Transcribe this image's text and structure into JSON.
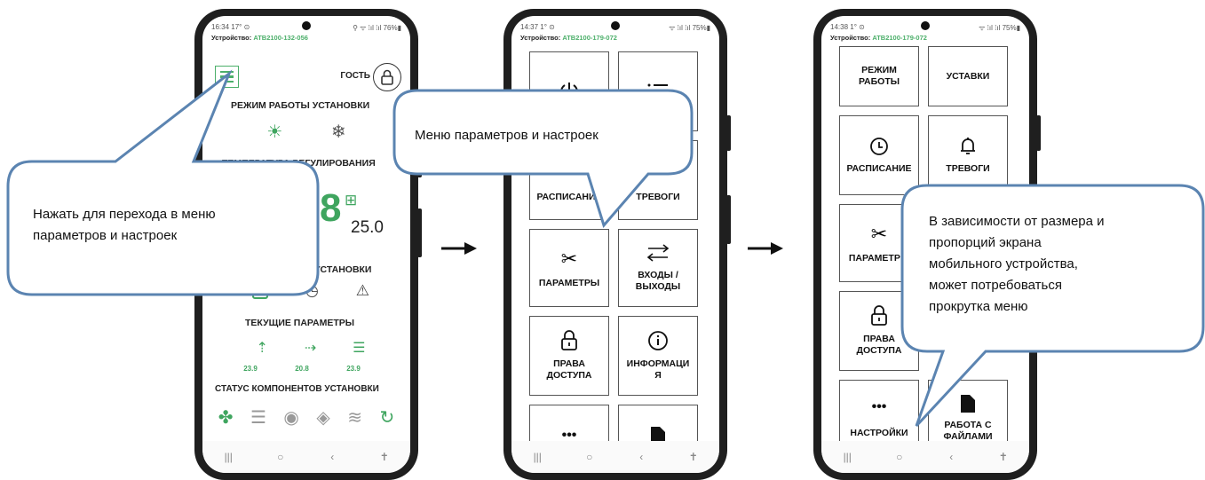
{
  "phones": [
    {
      "time": "16:34 17° ⊙",
      "signal": "⚲ ᯤ ⁞ıl ⁞ıl 76%▮",
      "device_label": "Устройство:",
      "device_id": "ATB2100-132-056",
      "guest": "ГОСТЬ",
      "mode_title": "РЕЖИМ РАБОТЫ УСТАНОВКИ",
      "temp_title": "ТЕМПЕРАТУРА РЕГУЛИРОВАНИЯ",
      "temp_value": "25.0",
      "install_title": "УСТАНОВКИ",
      "current_title": "ТЕКУЩИЕ ПАРАМЕТРЫ",
      "current_values": [
        "23.9",
        "20.8",
        "23.9"
      ],
      "status_title": "СТАТУС КОМПОНЕНТОВ УСТАНОВКИ"
    },
    {
      "time": "14:37 1° ⊙",
      "signal": "ᯤ ⁞ıl ⁞ıl 75%▮",
      "device_label": "Устройство:",
      "device_id": "ATB2100-179-072",
      "tiles": {
        "schedule": "РАСПИСАНИЕ",
        "alarms": "ТРЕВОГИ",
        "params": "ПАРАМЕТРЫ",
        "io_line1": "ВХОДЫ /",
        "io_line2": "ВЫХОДЫ",
        "access_line1": "ПРАВА",
        "access_line2": "ДОСТУПА",
        "info_line1": "ИНФОРМАЦИ",
        "info_line2": "Я",
        "more": "•••"
      }
    },
    {
      "time": "14:38 1° ⊙",
      "signal": "ᯤ ⁞ıl ⁞ıl 75%▮",
      "device_label": "Устройство:",
      "device_id": "ATB2100-179-072",
      "tiles": {
        "mode_line1": "РЕЖИМ",
        "mode_line2": "РАБОТЫ",
        "settings_values": "УСТАВКИ",
        "schedule": "РАСПИСАНИЕ",
        "alarms": "ТРЕВОГИ",
        "params": "ПАРАМЕТРЫ",
        "access_line1": "ПРАВА",
        "access_line2": "ДОСТУПА",
        "more": "•••",
        "settings": "НАСТРОЙКИ",
        "files_line1": "РАБОТА С",
        "files_line2": "ФАЙЛАМИ"
      }
    }
  ],
  "nav": {
    "recent": "|||",
    "home": "○",
    "back": "‹",
    "access": "✝"
  },
  "callouts": {
    "c1_line1": "Нажать для перехода в меню",
    "c1_line2": "параметров и настроек",
    "c2": "Меню параметров и настроек",
    "c3_line1": "В зависимости от размера и",
    "c3_line2": "пропорций экрана",
    "c3_line3": "мобильного устройства,",
    "c3_line4": "может потребоваться",
    "c3_line5": "прокрутка меню"
  },
  "colors": {
    "accent_green": "#3fa55f",
    "callout_border": "#5b84b1",
    "phone_frame": "#1f1f1f"
  }
}
